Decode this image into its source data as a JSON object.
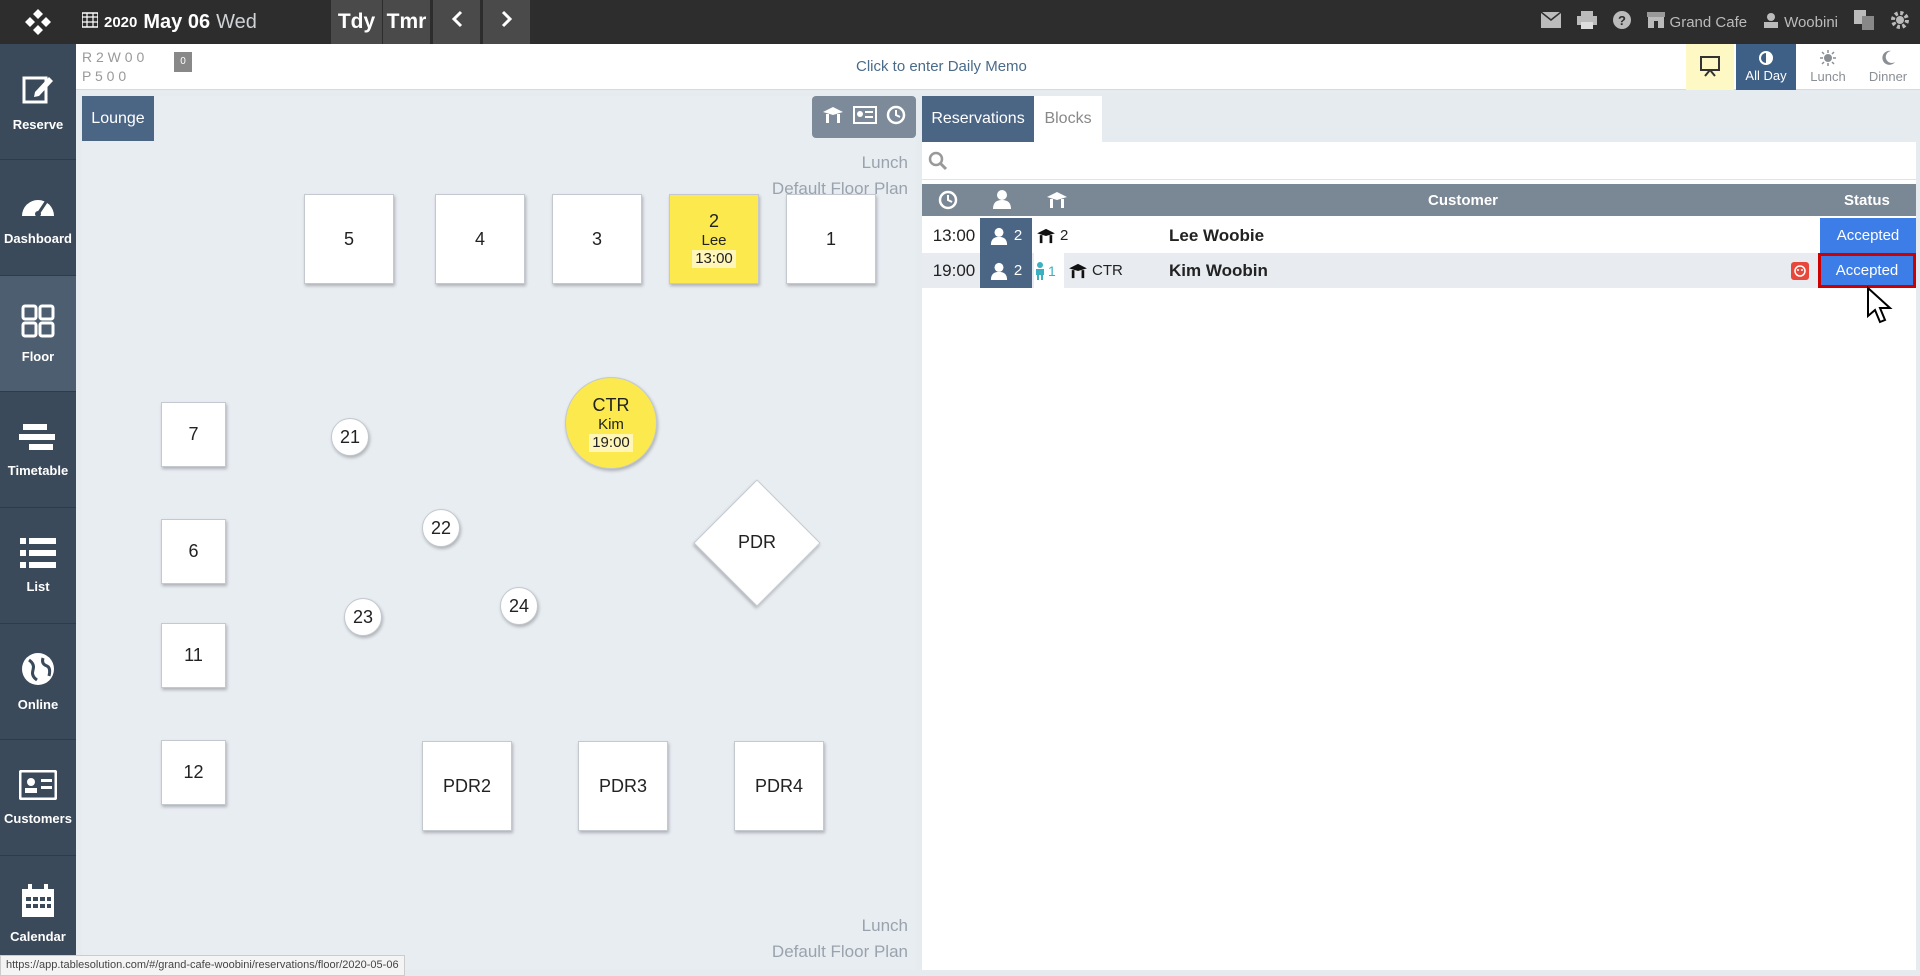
{
  "topbar": {
    "year": "2020",
    "month_day": "May 06",
    "weekday": "Wed",
    "today_label": "Tdy",
    "tomorrow_label": "Tmr",
    "restaurant": "Grand Cafe",
    "user": "Woobini"
  },
  "sidebar": {
    "items": [
      {
        "label": "Reserve",
        "icon": "edit-icon"
      },
      {
        "label": "Dashboard",
        "icon": "speedometer-icon"
      },
      {
        "label": "Floor",
        "icon": "grid-icon"
      },
      {
        "label": "Timetable",
        "icon": "timetable-icon"
      },
      {
        "label": "List",
        "icon": "list-icon"
      },
      {
        "label": "Online",
        "icon": "globe-icon"
      },
      {
        "label": "Customers",
        "icon": "id-card-icon"
      },
      {
        "label": "Calendar",
        "icon": "calendar-icon"
      }
    ]
  },
  "info": {
    "counts_row1": "R 2 W 0  0",
    "counts_row2": "P 5   0   0",
    "badge": "0",
    "memo": "Click to enter Daily Memo",
    "periods": {
      "all_day": "All Day",
      "lunch": "Lunch",
      "dinner": "Dinner"
    }
  },
  "floor": {
    "tab": "Lounge",
    "plan_service": "Lunch",
    "plan_name": "Default Floor Plan",
    "tables": {
      "t5": "5",
      "t4": "4",
      "t3": "3",
      "t2": "2",
      "t1": "1",
      "t2_name": "Lee",
      "t2_time": "13:00",
      "t7": "7",
      "t6": "6",
      "t11": "11",
      "t12": "12",
      "t21": "21",
      "t22": "22",
      "t23": "23",
      "t24": "24",
      "ctr": "CTR",
      "ctr_name": "Kim",
      "ctr_time": "19:00",
      "pdr": "PDR",
      "pdr2": "PDR2",
      "pdr3": "PDR3",
      "pdr4": "PDR4"
    }
  },
  "reservations": {
    "tabs": {
      "reservations": "Reservations",
      "blocks": "Blocks"
    },
    "columns": {
      "customer": "Customer",
      "status": "Status"
    },
    "rows": [
      {
        "time": "13:00",
        "pax": "2",
        "child": "",
        "table": "2",
        "customer": "Lee Woobie",
        "status": "Accepted"
      },
      {
        "time": "19:00",
        "pax": "2",
        "child": "1",
        "table": "CTR",
        "customer": "Kim Woobin",
        "status": "Accepted"
      }
    ]
  },
  "status_url": "https://app.tablesolution.com/#/grand-cafe-woobini/reservations/floor/2020-05-06",
  "colors": {
    "accent": "#4b6585",
    "booked": "#fbe94e",
    "status": "#3d7de8",
    "highlight": "#cc0000"
  }
}
